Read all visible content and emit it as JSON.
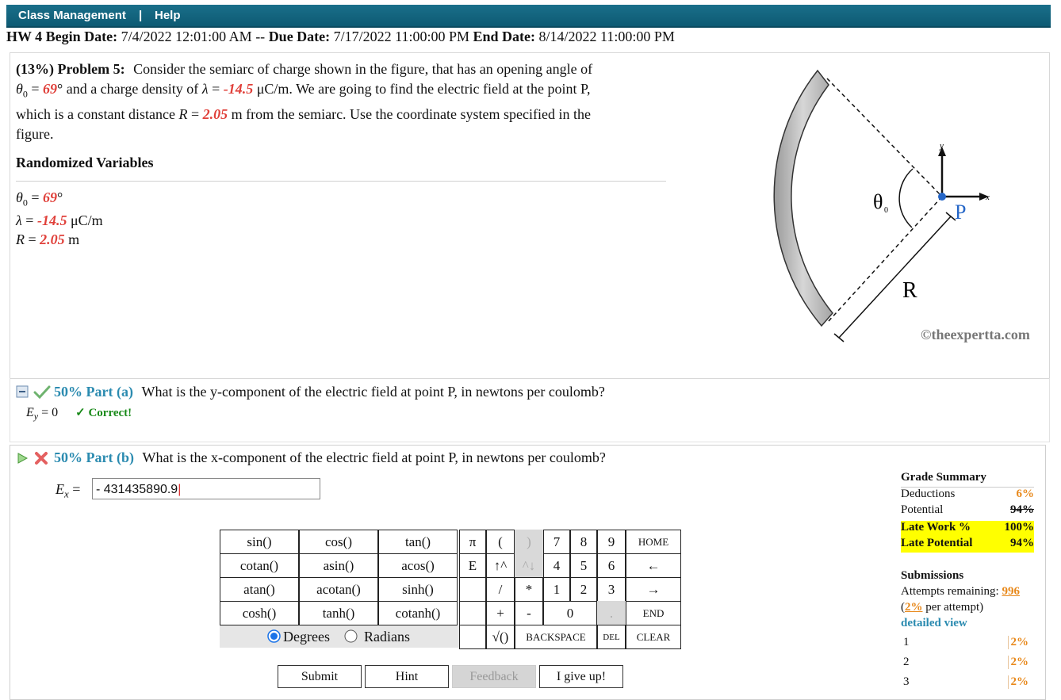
{
  "topbar": {
    "class_management": "Class Management",
    "separator": "|",
    "help": "Help"
  },
  "dates": {
    "hw_label": "HW 4 Begin Date:",
    "begin": "7/4/2022 12:01:00 AM",
    "sep": "--",
    "due_label": "Due Date:",
    "due": "7/17/2022 11:00:00 PM",
    "end_label": "End Date:",
    "end": "8/14/2022 11:00:00 PM"
  },
  "problem": {
    "weight": "(13%)",
    "number": "Problem 5:",
    "text1": "Consider the semiarc of charge shown in the figure, that has an opening angle of",
    "theta_sym": "θ",
    "theta_sub": "0",
    "eq": " = ",
    "theta_val": "69",
    "text2": "° and a charge density of ",
    "lambda_sym": "λ",
    "lambda_val": "-14.5",
    "text3": " μC/m. We are going to find the electric field at the point P,",
    "text4": "which is a constant distance ",
    "r_sym": "R",
    "r_val": "2.05",
    "text5": " m from the semiarc. Use the coordinate system specified in the",
    "text6": "figure."
  },
  "randomized": {
    "title": "Randomized Variables",
    "theta_unit": "°",
    "lambda_unit": " μC/m",
    "r_unit": " m"
  },
  "figure": {
    "theta_label": "θ",
    "theta_sub": "0",
    "p_label": "P",
    "x_label": "x",
    "y_label": "y",
    "r_label": "R",
    "watermark": "©theexpertta.com"
  },
  "part_a": {
    "pct": "50% Part (a)",
    "question": "What is the y-component of the electric field at point P, in newtons per coulomb?",
    "var": "E",
    "var_sub": "y",
    "answer": " = 0",
    "correct": "✓ Correct!"
  },
  "part_b": {
    "pct": "50% Part (b)",
    "question": "What is the x-component of the electric field at point P, in newtons per coulomb?",
    "var": "E",
    "var_sub": "x",
    "eq": " = ",
    "answer_value": "- 431435890.9"
  },
  "calculator": {
    "funcs": [
      "sin()",
      "cos()",
      "tan()",
      "cotan()",
      "asin()",
      "acos()",
      "atan()",
      "acotan()",
      "sinh()",
      "cosh()",
      "tanh()",
      "cotanh()"
    ],
    "degrees": "Degrees",
    "radians": "Radians",
    "mode_selected": "Degrees",
    "pi": "π",
    "lparen": "(",
    "rparen": ")",
    "e": "E",
    "up": "↑^",
    "down": "^↓",
    "slash": "/",
    "star": "*",
    "plus": "+",
    "minus": "-",
    "sqrt": "√()",
    "dot": ".",
    "digits": [
      "7",
      "8",
      "9",
      "4",
      "5",
      "6",
      "1",
      "2",
      "3",
      "0"
    ],
    "home": "HOME",
    "left": "←",
    "right": "→",
    "end": "END",
    "backspace": "BACKSPACE",
    "del": "DEL",
    "clear": "CLEAR"
  },
  "buttons": {
    "submit": "Submit",
    "hint": "Hint",
    "feedback": "Feedback",
    "give_up": "I give up!"
  },
  "grade_summary": {
    "title": "Grade Summary",
    "deductions_label": "Deductions",
    "deductions": "6%",
    "potential_label": "Potential",
    "potential": "94%",
    "late_work_label": "Late Work %",
    "late_work": "100%",
    "late_potential_label": "Late Potential",
    "late_potential": "94%"
  },
  "submissions": {
    "title": "Submissions",
    "attempts_label": "Attempts remaining:",
    "attempts": "996",
    "per_attempt_open": "(",
    "per_attempt_pct": "2%",
    "per_attempt_close": " per attempt)",
    "detailed_view": "detailed view",
    "rows": [
      {
        "n": "1",
        "p": "2%"
      },
      {
        "n": "2",
        "p": "2%"
      },
      {
        "n": "3",
        "p": "2%"
      }
    ]
  }
}
